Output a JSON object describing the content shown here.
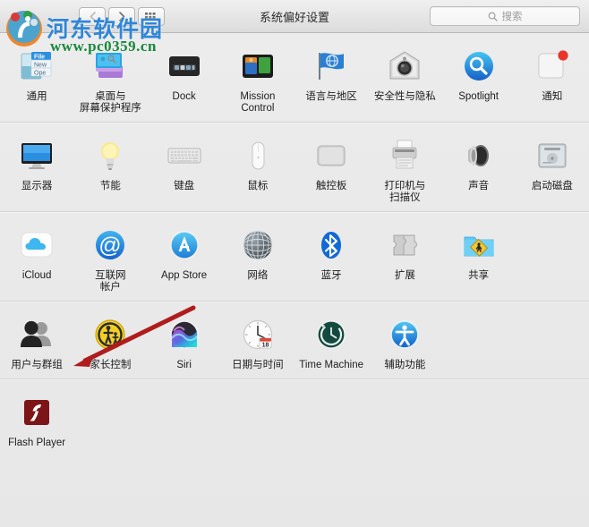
{
  "window": {
    "title": "系统偏好设置"
  },
  "toolbar": {
    "back_label": "‹",
    "forward_label": "›",
    "showall_label": "⠿",
    "back_icon": "chevron-left-icon",
    "forward_icon": "chevron-right-icon",
    "showall_icon": "grid-icon"
  },
  "search": {
    "placeholder": "搜索",
    "value": "",
    "icon": "search-icon"
  },
  "watermark": {
    "site_name": "河东软件园",
    "url": "www.pc0359.cn",
    "logo_icon": "site-logo-icon"
  },
  "annotation": {
    "arrow_color": "#b01c1c",
    "arrow_icon": "red-arrow-icon",
    "points_at": "用户与群组"
  },
  "colors": {
    "window_bg": "#e9e9e9",
    "toolbar_top": "#f0f0f0",
    "toolbar_bottom": "#dcdcdc",
    "separator": "#d2d2d2",
    "label_text": "#1d1d1d",
    "title_text": "#2b2b2b",
    "placeholder_text": "#9b9b9b",
    "accent_blue": "#2f86d8",
    "badge_red": "#e8342a"
  },
  "rows": [
    {
      "panes": [
        {
          "label": "通用",
          "icon": "general-icon"
        },
        {
          "label": "桌面与\n屏幕保护程序",
          "icon": "desktop-screensaver-icon"
        },
        {
          "label": "Dock",
          "icon": "dock-icon"
        },
        {
          "label": "Mission\nControl",
          "icon": "mission-control-icon"
        },
        {
          "label": "语言与地区",
          "icon": "language-region-icon"
        },
        {
          "label": "安全性与隐私",
          "icon": "security-privacy-icon"
        },
        {
          "label": "Spotlight",
          "icon": "spotlight-icon"
        },
        {
          "label": "通知",
          "icon": "notifications-icon"
        }
      ]
    },
    {
      "panes": [
        {
          "label": "显示器",
          "icon": "displays-icon"
        },
        {
          "label": "节能",
          "icon": "energy-saver-icon"
        },
        {
          "label": "键盘",
          "icon": "keyboard-icon"
        },
        {
          "label": "鼠标",
          "icon": "mouse-icon"
        },
        {
          "label": "触控板",
          "icon": "trackpad-icon"
        },
        {
          "label": "打印机与\n扫描仪",
          "icon": "printers-scanners-icon"
        },
        {
          "label": "声音",
          "icon": "sound-icon"
        },
        {
          "label": "启动磁盘",
          "icon": "startup-disk-icon"
        }
      ]
    },
    {
      "panes": [
        {
          "label": "iCloud",
          "icon": "icloud-icon"
        },
        {
          "label": "互联网\n帐户",
          "icon": "internet-accounts-icon"
        },
        {
          "label": "App Store",
          "icon": "app-store-icon"
        },
        {
          "label": "网络",
          "icon": "network-icon"
        },
        {
          "label": "蓝牙",
          "icon": "bluetooth-icon"
        },
        {
          "label": "扩展",
          "icon": "extensions-icon"
        },
        {
          "label": "共享",
          "icon": "sharing-icon"
        }
      ]
    },
    {
      "panes": [
        {
          "label": "用户与群组",
          "icon": "users-groups-icon"
        },
        {
          "label": "家长控制",
          "icon": "parental-controls-icon"
        },
        {
          "label": "Siri",
          "icon": "siri-icon"
        },
        {
          "label": "日期与时间",
          "icon": "date-time-icon"
        },
        {
          "label": "Time Machine",
          "icon": "time-machine-icon"
        },
        {
          "label": "辅助功能",
          "icon": "accessibility-icon"
        }
      ]
    },
    {
      "panes": [
        {
          "label": "Flash Player",
          "icon": "flash-player-icon"
        }
      ]
    }
  ]
}
